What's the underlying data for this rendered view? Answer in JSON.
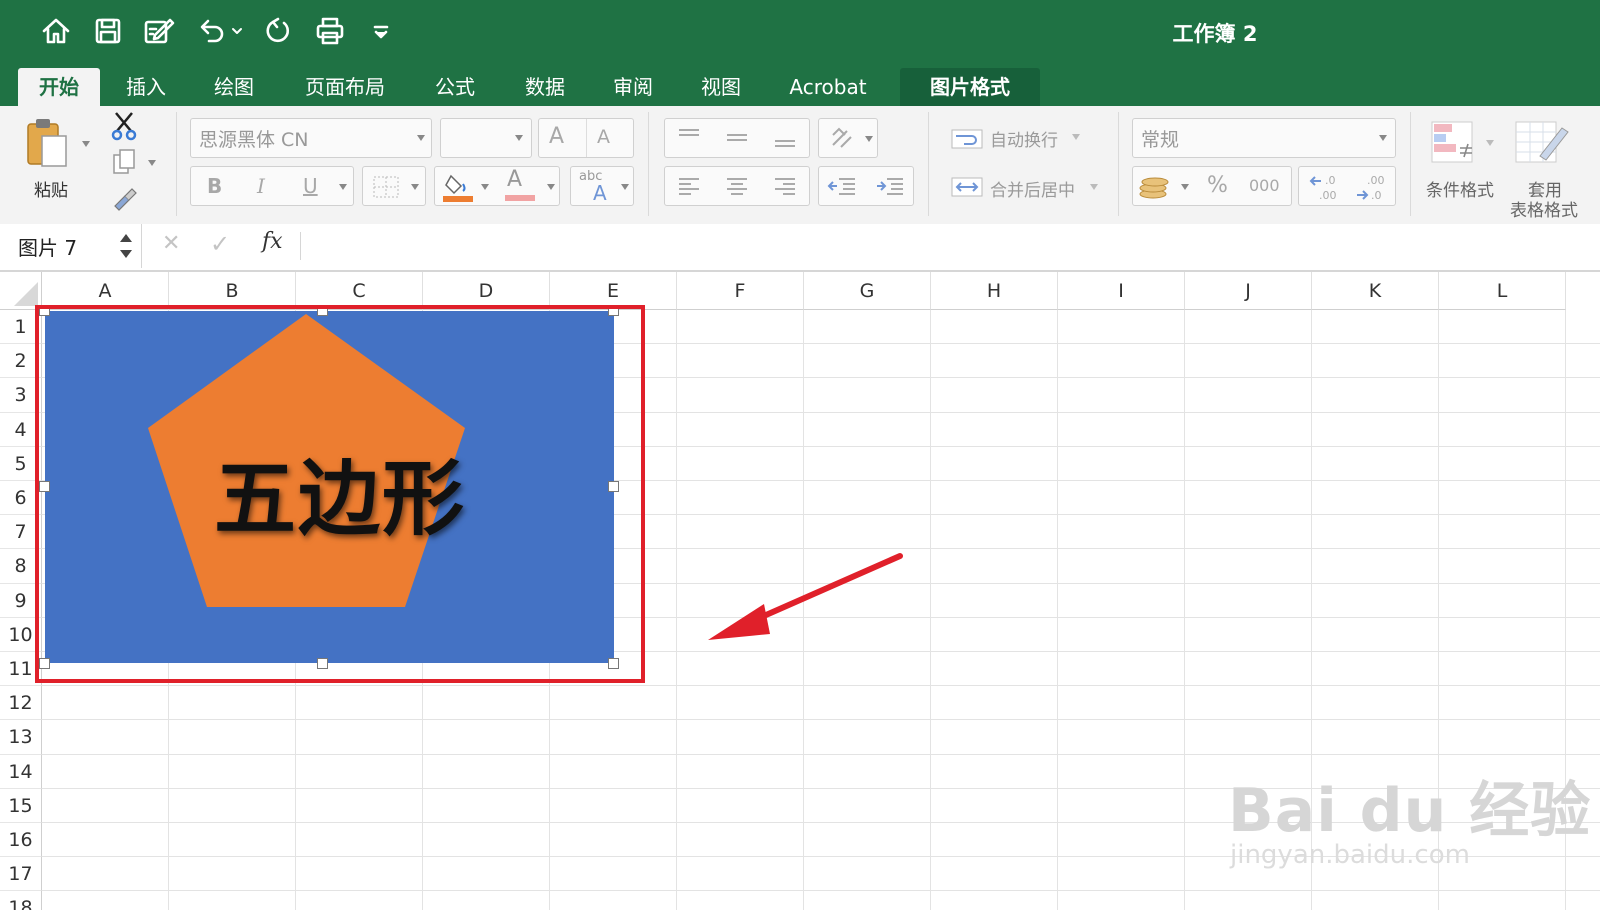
{
  "window": {
    "title": "工作簿 2"
  },
  "quick_access": {
    "icons": [
      "home-icon",
      "save-icon",
      "edit-icon",
      "undo-icon",
      "redo-icon",
      "print-icon",
      "more-icon"
    ]
  },
  "tabs": [
    {
      "label": "开始",
      "active": true
    },
    {
      "label": "插入"
    },
    {
      "label": "绘图"
    },
    {
      "label": "页面布局"
    },
    {
      "label": "公式"
    },
    {
      "label": "数据"
    },
    {
      "label": "审阅"
    },
    {
      "label": "视图"
    },
    {
      "label": "Acrobat"
    },
    {
      "label": "图片格式",
      "contextual": true
    }
  ],
  "ribbon": {
    "paste_label": "粘贴",
    "font_name": "思源黑体 CN",
    "font_size": "",
    "bold": "B",
    "italic": "I",
    "underline": "U",
    "grow_font": "A",
    "shrink_font": "A",
    "font_color_letter": "A",
    "abc": "abc",
    "wrap_text": "自动换行",
    "merge_center": "合并后居中",
    "number_format": "常规",
    "percent": "%",
    "thousands": "000",
    "inc_decimal": ".00",
    "dec_decimal": ".00",
    "conditional_format": "条件格式",
    "table_format_line1": "套用",
    "table_format_line2": "表格格式"
  },
  "formula_bar": {
    "name_box": "图片 7",
    "cancel": "✕",
    "enter": "✓",
    "fx": "fx",
    "formula": ""
  },
  "columns": [
    "A",
    "B",
    "C",
    "D",
    "E",
    "F",
    "G",
    "H",
    "I",
    "J",
    "K",
    "L"
  ],
  "rows": [
    "1",
    "2",
    "3",
    "4",
    "5",
    "6",
    "7",
    "8",
    "9",
    "10",
    "11",
    "12",
    "13",
    "14",
    "15",
    "16",
    "17",
    "18"
  ],
  "picture": {
    "text": "五边形",
    "background": "#4472c4",
    "shape_color": "#ed7d31"
  },
  "colors": {
    "excel_green": "#1f7244",
    "selection_red": "#e0202a",
    "arrow_red": "#e0202a"
  },
  "watermark": {
    "line1": "Bai du 经验",
    "line2": "jingyan.baidu.com"
  }
}
